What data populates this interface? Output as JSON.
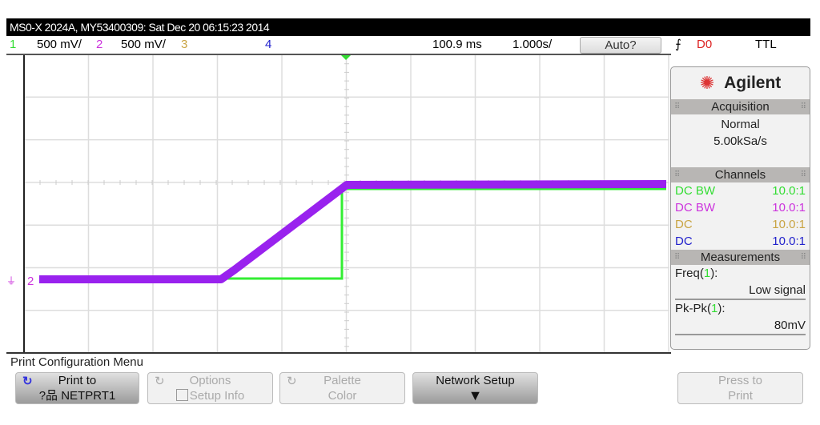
{
  "title": "MS0-X 2024A, MY53400309: Sat Dec 20 06:15:23 2014",
  "channels": [
    {
      "num": "1",
      "scale": "500 mV/",
      "color": "#33dd33"
    },
    {
      "num": "2",
      "scale": "500 mV/",
      "color": "#cc33dd"
    },
    {
      "num": "3",
      "color": "#c9a443"
    },
    {
      "num": "4",
      "color": "#2222cc"
    }
  ],
  "timebase": {
    "delay": "100.9 ms",
    "scale": "1.000s/"
  },
  "trigger": {
    "mode": "Auto?",
    "edge": "rising-edge-icon",
    "source": "D0",
    "level": "TTL"
  },
  "panel": {
    "brand": "Agilent",
    "acquisition": {
      "header": "Acquisition",
      "mode": "Normal",
      "rate": "5.00kSa/s"
    },
    "channels": {
      "header": "Channels",
      "rows": [
        {
          "coupling": "DC BW",
          "probe": "10.0:1",
          "color": "#33dd33"
        },
        {
          "coupling": "DC BW",
          "probe": "10.0:1",
          "color": "#cc33dd"
        },
        {
          "coupling": "DC",
          "probe": "10.0:1",
          "color": "#c9a443"
        },
        {
          "coupling": "DC",
          "probe": "10.0:1",
          "color": "#2222cc"
        }
      ]
    },
    "measurements": {
      "header": "Measurements",
      "items": [
        {
          "label": "Freq(",
          "ch": "1",
          "close": "):",
          "value": "Low signal"
        },
        {
          "label": "Pk-Pk(",
          "ch": "1",
          "close": "):",
          "value": "80mV"
        }
      ]
    }
  },
  "ground_marker": "2",
  "menu": {
    "title": "Print Configuration Menu",
    "softkeys": [
      {
        "line1": "Print to",
        "line2": "?品 NETPRT1"
      },
      {
        "line1": "Options",
        "line2": "Setup Info"
      },
      {
        "line1": "Palette",
        "line2": "Color"
      },
      {
        "line1": "Network Setup"
      },
      {
        "line1": "Press to",
        "line2": "Print"
      }
    ]
  }
}
